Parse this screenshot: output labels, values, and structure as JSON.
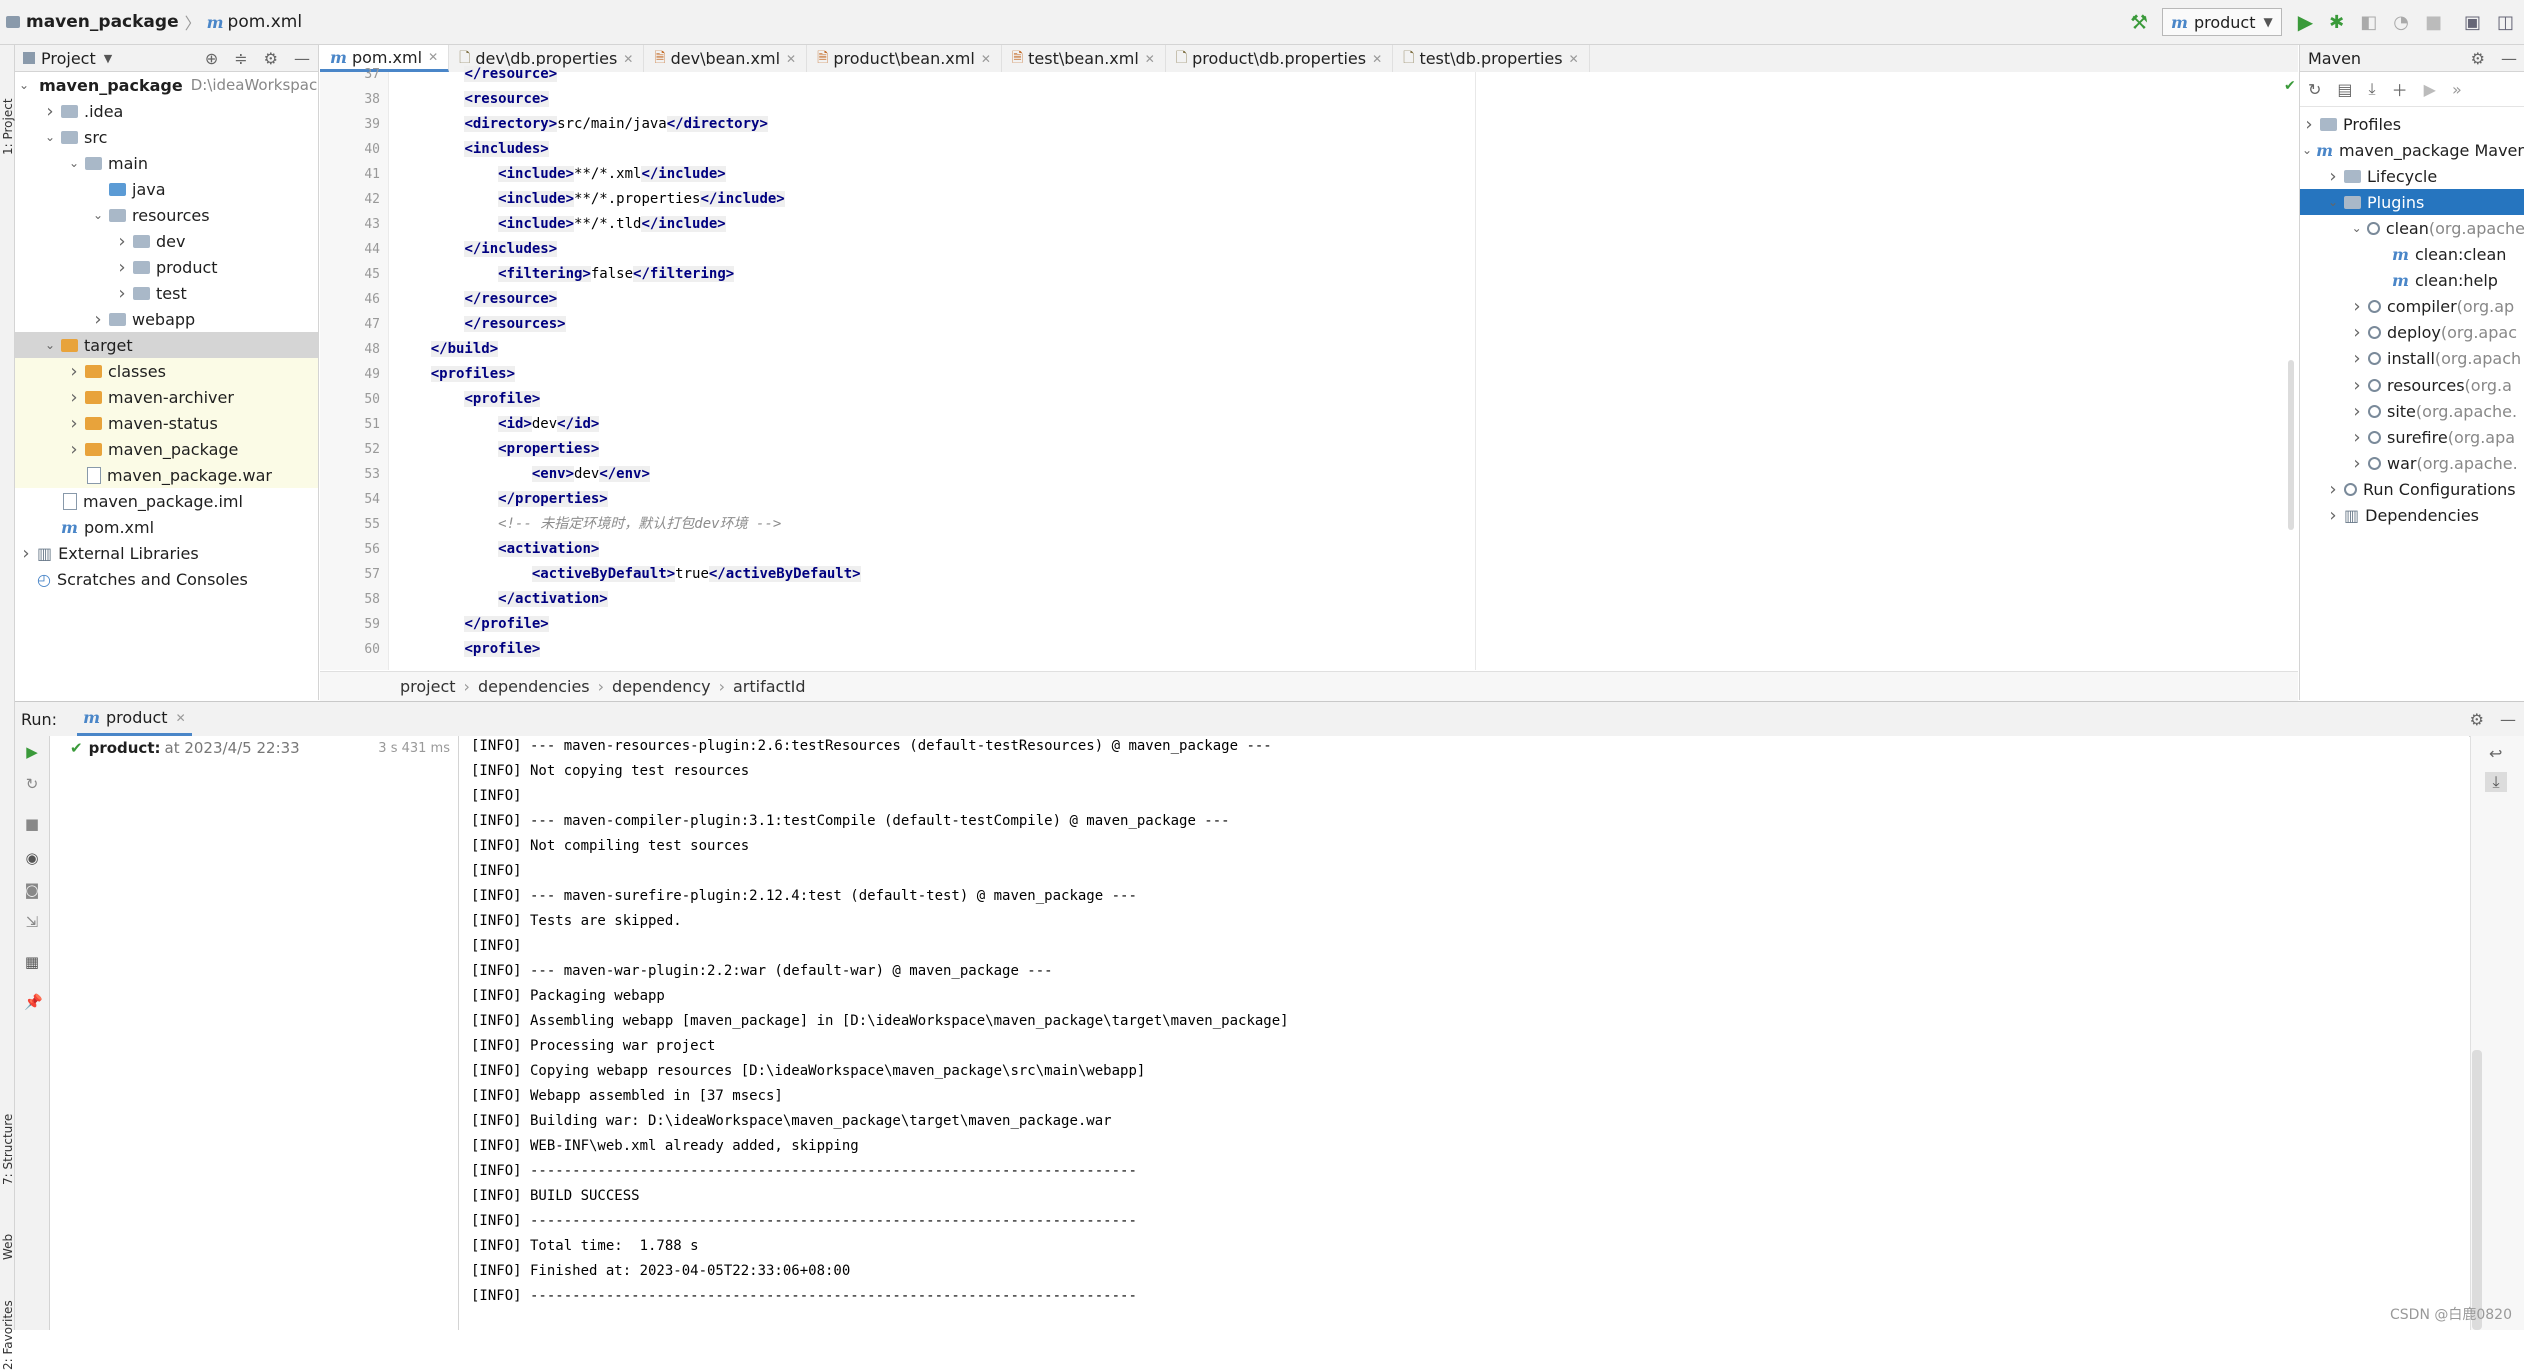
{
  "titlebar": {
    "project_name": "maven_package",
    "file_name": "pom.xml",
    "run_config": "product"
  },
  "left_stripe": {
    "project_label": "1: Project",
    "structure_label": "7: Structure",
    "web_label": "Web",
    "favorites_label": "2: Favorites"
  },
  "project_panel": {
    "title": "Project",
    "tree": [
      {
        "label": "maven_package",
        "note": "D:\\ideaWorkspace\\maven_package",
        "indent": 0,
        "arrow": "down",
        "icon": "folder",
        "bold": true
      },
      {
        "label": ".idea",
        "indent": 1,
        "arrow": "right",
        "icon": "folder"
      },
      {
        "label": "src",
        "indent": 1,
        "arrow": "down",
        "icon": "folder"
      },
      {
        "label": "main",
        "indent": 2,
        "arrow": "down",
        "icon": "folder"
      },
      {
        "label": "java",
        "indent": 3,
        "arrow": "",
        "icon": "folder-blue"
      },
      {
        "label": "resources",
        "indent": 3,
        "arrow": "down",
        "icon": "folder"
      },
      {
        "label": "dev",
        "indent": 4,
        "arrow": "right",
        "icon": "folder"
      },
      {
        "label": "product",
        "indent": 4,
        "arrow": "right",
        "icon": "folder"
      },
      {
        "label": "test",
        "indent": 4,
        "arrow": "right",
        "icon": "folder"
      },
      {
        "label": "webapp",
        "indent": 3,
        "arrow": "right",
        "icon": "folder"
      },
      {
        "label": "target",
        "indent": 1,
        "arrow": "down",
        "icon": "folder-orange",
        "selected": true
      },
      {
        "label": "classes",
        "indent": 2,
        "arrow": "right",
        "icon": "folder-orange",
        "yellow": true
      },
      {
        "label": "maven-archiver",
        "indent": 2,
        "arrow": "right",
        "icon": "folder-orange",
        "yellow": true
      },
      {
        "label": "maven-status",
        "indent": 2,
        "arrow": "right",
        "icon": "folder-orange",
        "yellow": true
      },
      {
        "label": "maven_package",
        "indent": 2,
        "arrow": "right",
        "icon": "folder-orange",
        "yellow": true
      },
      {
        "label": "maven_package.war",
        "indent": 2,
        "arrow": "",
        "icon": "file",
        "yellow": true
      },
      {
        "label": "maven_package.iml",
        "indent": 1,
        "arrow": "",
        "icon": "file"
      },
      {
        "label": "pom.xml",
        "indent": 1,
        "arrow": "",
        "icon": "m"
      },
      {
        "label": "External Libraries",
        "indent": 0,
        "arrow": "right",
        "icon": "lib"
      },
      {
        "label": "Scratches and Consoles",
        "indent": 0,
        "arrow": "",
        "icon": "scratch"
      }
    ]
  },
  "editor": {
    "tabs": [
      {
        "label": "pom.xml",
        "icon": "m",
        "active": true
      },
      {
        "label": "dev\\db.properties",
        "icon": "props"
      },
      {
        "label": "dev\\bean.xml",
        "icon": "xml"
      },
      {
        "label": "product\\bean.xml",
        "icon": "xml"
      },
      {
        "label": "test\\bean.xml",
        "icon": "xml"
      },
      {
        "label": "product\\db.properties",
        "icon": "props"
      },
      {
        "label": "test\\db.properties",
        "icon": "props"
      }
    ],
    "lines": [
      {
        "n": "37",
        "parts": [
          {
            "t": "        "
          },
          {
            "t": "</resource>",
            "c": "tag"
          }
        ]
      },
      {
        "n": "38",
        "parts": [
          {
            "t": "        "
          },
          {
            "t": "<resource>",
            "c": "tag"
          }
        ]
      },
      {
        "n": "39",
        "parts": [
          {
            "t": "        "
          },
          {
            "t": "<directory>",
            "c": "tag"
          },
          {
            "t": "src/main/java"
          },
          {
            "t": "</directory>",
            "c": "tag"
          }
        ]
      },
      {
        "n": "40",
        "parts": [
          {
            "t": "        "
          },
          {
            "t": "<includes>",
            "c": "tag"
          }
        ]
      },
      {
        "n": "41",
        "parts": [
          {
            "t": "            "
          },
          {
            "t": "<include>",
            "c": "tag"
          },
          {
            "t": "**/*.xml"
          },
          {
            "t": "</include>",
            "c": "tag"
          }
        ]
      },
      {
        "n": "42",
        "parts": [
          {
            "t": "            "
          },
          {
            "t": "<include>",
            "c": "tag"
          },
          {
            "t": "**/*.properties"
          },
          {
            "t": "</include>",
            "c": "tag"
          }
        ]
      },
      {
        "n": "43",
        "parts": [
          {
            "t": "            "
          },
          {
            "t": "<include>",
            "c": "tag"
          },
          {
            "t": "**/*.tld"
          },
          {
            "t": "</include>",
            "c": "tag"
          }
        ]
      },
      {
        "n": "44",
        "parts": [
          {
            "t": "        "
          },
          {
            "t": "</includes>",
            "c": "tag"
          }
        ]
      },
      {
        "n": "45",
        "parts": [
          {
            "t": "            "
          },
          {
            "t": "<filtering>",
            "c": "tag"
          },
          {
            "t": "false"
          },
          {
            "t": "</filtering>",
            "c": "tag"
          }
        ]
      },
      {
        "n": "46",
        "parts": [
          {
            "t": "        "
          },
          {
            "t": "</resource>",
            "c": "tag"
          }
        ]
      },
      {
        "n": "47",
        "parts": [
          {
            "t": "        "
          },
          {
            "t": "</resources>",
            "c": "tag"
          }
        ]
      },
      {
        "n": "48",
        "parts": [
          {
            "t": "    "
          },
          {
            "t": "</build>",
            "c": "tag"
          }
        ]
      },
      {
        "n": "49",
        "parts": [
          {
            "t": "    "
          },
          {
            "t": "<profiles>",
            "c": "tag"
          }
        ]
      },
      {
        "n": "50",
        "parts": [
          {
            "t": "        "
          },
          {
            "t": "<profile>",
            "c": "tag"
          }
        ]
      },
      {
        "n": "51",
        "parts": [
          {
            "t": "            "
          },
          {
            "t": "<id>",
            "c": "tag"
          },
          {
            "t": "dev"
          },
          {
            "t": "</id>",
            "c": "tag"
          }
        ]
      },
      {
        "n": "52",
        "parts": [
          {
            "t": "            "
          },
          {
            "t": "<properties>",
            "c": "tag"
          }
        ]
      },
      {
        "n": "53",
        "parts": [
          {
            "t": "                "
          },
          {
            "t": "<env>",
            "c": "tag"
          },
          {
            "t": "dev"
          },
          {
            "t": "</env>",
            "c": "tag"
          }
        ]
      },
      {
        "n": "54",
        "parts": [
          {
            "t": "            "
          },
          {
            "t": "</properties>",
            "c": "tag"
          }
        ]
      },
      {
        "n": "55",
        "parts": [
          {
            "t": "            "
          },
          {
            "t": "<!-- 未指定环境时，默认打包dev环境 -->",
            "c": "cmt"
          }
        ]
      },
      {
        "n": "56",
        "parts": [
          {
            "t": "            "
          },
          {
            "t": "<activation>",
            "c": "tag"
          }
        ]
      },
      {
        "n": "57",
        "parts": [
          {
            "t": "                "
          },
          {
            "t": "<activeByDefault>",
            "c": "tag"
          },
          {
            "t": "true"
          },
          {
            "t": "</activeByDefault>",
            "c": "tag"
          }
        ]
      },
      {
        "n": "58",
        "parts": [
          {
            "t": "            "
          },
          {
            "t": "</activation>",
            "c": "tag"
          }
        ]
      },
      {
        "n": "59",
        "parts": [
          {
            "t": "        "
          },
          {
            "t": "</profile>",
            "c": "tag"
          }
        ]
      },
      {
        "n": "60",
        "parts": [
          {
            "t": "        "
          },
          {
            "t": "<profile>",
            "c": "tag"
          }
        ]
      }
    ],
    "breadcrumbs": [
      "project",
      "dependencies",
      "dependency",
      "artifactId"
    ]
  },
  "maven_panel": {
    "title": "Maven",
    "tree": [
      {
        "label": "Profiles",
        "indent": 0,
        "arrow": "right",
        "icon": "folder"
      },
      {
        "label": "maven_package Maven",
        "indent": 0,
        "arrow": "down",
        "icon": "m"
      },
      {
        "label": "Lifecycle",
        "indent": 1,
        "arrow": "right",
        "icon": "folder"
      },
      {
        "label": "Plugins",
        "indent": 1,
        "arrow": "down",
        "icon": "folder",
        "selected": true
      },
      {
        "label": "clean",
        "note": " (org.apache",
        "indent": 2,
        "arrow": "down",
        "icon": "gear"
      },
      {
        "label": "clean:clean",
        "indent": 3,
        "arrow": "",
        "icon": "m"
      },
      {
        "label": "clean:help",
        "indent": 3,
        "arrow": "",
        "icon": "m"
      },
      {
        "label": "compiler",
        "note": " (org.ap",
        "indent": 2,
        "arrow": "right",
        "icon": "gear"
      },
      {
        "label": "deploy",
        "note": " (org.apac",
        "indent": 2,
        "arrow": "right",
        "icon": "gear"
      },
      {
        "label": "install",
        "note": " (org.apach",
        "indent": 2,
        "arrow": "right",
        "icon": "gear"
      },
      {
        "label": "resources",
        "note": " (org.a",
        "indent": 2,
        "arrow": "right",
        "icon": "gear"
      },
      {
        "label": "site",
        "note": " (org.apache.",
        "indent": 2,
        "arrow": "right",
        "icon": "gear"
      },
      {
        "label": "surefire",
        "note": " (org.apa",
        "indent": 2,
        "arrow": "right",
        "icon": "gear"
      },
      {
        "label": "war",
        "note": " (org.apache.",
        "indent": 2,
        "arrow": "right",
        "icon": "gear"
      },
      {
        "label": "Run Configurations",
        "indent": 1,
        "arrow": "right",
        "icon": "gear"
      },
      {
        "label": "Dependencies",
        "indent": 1,
        "arrow": "right",
        "icon": "lib"
      }
    ]
  },
  "run_panel": {
    "label": "Run:",
    "tab": "product",
    "result_name": "product:",
    "result_time": "at 2023/4/5 22:33",
    "duration": "3 s 431 ms",
    "console": [
      "[INFO] --- maven-resources-plugin:2.6:testResources (default-testResources) @ maven_package ---",
      "[INFO] Not copying test resources",
      "[INFO]",
      "[INFO] --- maven-compiler-plugin:3.1:testCompile (default-testCompile) @ maven_package ---",
      "[INFO] Not compiling test sources",
      "[INFO]",
      "[INFO] --- maven-surefire-plugin:2.12.4:test (default-test) @ maven_package ---",
      "[INFO] Tests are skipped.",
      "[INFO]",
      "[INFO] --- maven-war-plugin:2.2:war (default-war) @ maven_package ---",
      "[INFO] Packaging webapp",
      "[INFO] Assembling webapp [maven_package] in [D:\\ideaWorkspace\\maven_package\\target\\maven_package]",
      "[INFO] Processing war project",
      "[INFO] Copying webapp resources [D:\\ideaWorkspace\\maven_package\\src\\main\\webapp]",
      "[INFO] Webapp assembled in [37 msecs]",
      "[INFO] Building war: D:\\ideaWorkspace\\maven_package\\target\\maven_package.war",
      "[INFO] WEB-INF\\web.xml already added, skipping",
      "[INFO] ------------------------------------------------------------------------",
      "[INFO] BUILD SUCCESS",
      "[INFO] ------------------------------------------------------------------------",
      "[INFO] Total time:  1.788 s",
      "[INFO] Finished at: 2023-04-05T22:33:06+08:00",
      "[INFO] ------------------------------------------------------------------------"
    ]
  },
  "watermark": "CSDN @白鹿0820",
  "colors": {
    "accent": "#2675bf",
    "selection": "#d5d5d5",
    "tag": "#000080",
    "success": "#3a9a3a"
  }
}
